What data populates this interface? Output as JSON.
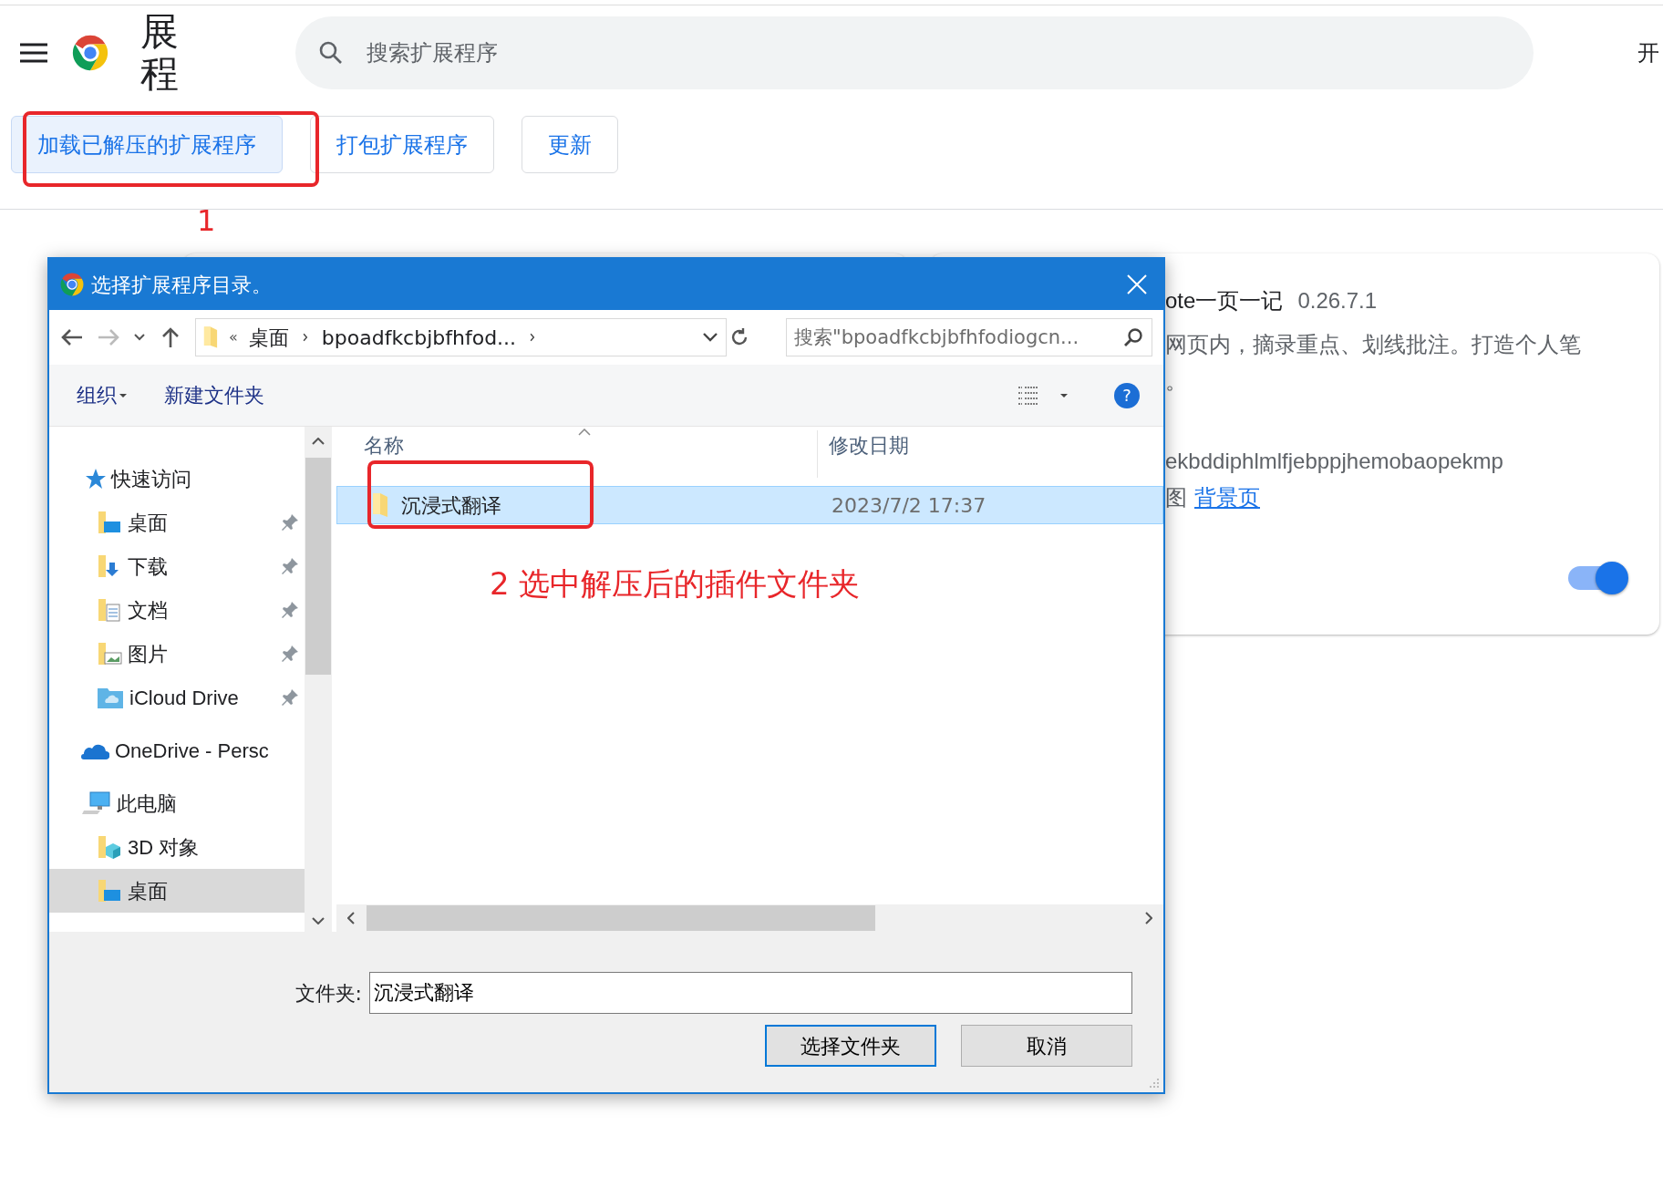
{
  "header": {
    "title": "展程",
    "search": {
      "placeholder": "搜索扩展程序"
    },
    "edge_text": "开"
  },
  "toolbar_buttons": [
    {
      "label": "加载已解压的扩展程序",
      "focused": true
    },
    {
      "label": "打包扩展程序",
      "focused": false
    },
    {
      "label": "更新",
      "focused": false
    }
  ],
  "extension_card": {
    "name": "ote一页一记",
    "version": "0.26.7.1",
    "description_lines": [
      "网页内，摘录重点、划线批注。打造个人笔",
      "。"
    ],
    "id": "ekbddiphlmlfjebppjhemobaopekmp",
    "views_label": "图",
    "views_link": "背景页",
    "enabled": true
  },
  "dialog": {
    "title": "选择扩展程序目录。",
    "path_overflow": "«",
    "path": [
      "桌面",
      "bpoadfkcbjbfhfod..."
    ],
    "search": {
      "placeholder": "搜索\"bpoadfkcbjbfhfodiogcn..."
    },
    "organize": "组织",
    "help_label": "?",
    "new_folder": "新建文件夹",
    "nav": [
      {
        "label": "快速访问",
        "kind": "star",
        "selected": false,
        "children": [
          {
            "label": "桌面",
            "kind": "desktop",
            "pinned": true,
            "selected": false
          },
          {
            "label": "下载",
            "kind": "download",
            "pinned": true,
            "selected": false
          },
          {
            "label": "文档",
            "kind": "documents",
            "pinned": true,
            "selected": false
          },
          {
            "label": "图片",
            "kind": "pictures",
            "pinned": true,
            "selected": false
          },
          {
            "label": "iCloud Drive",
            "kind": "icloud",
            "pinned": true,
            "selected": false
          }
        ]
      },
      {
        "label": "OneDrive - Persc",
        "kind": "onedrive",
        "selected": false
      },
      {
        "label": "此电脑",
        "kind": "computer",
        "selected": false,
        "children": [
          {
            "label": "3D 对象",
            "kind": "objects3d",
            "pinned": false,
            "selected": false
          },
          {
            "label": "桌面",
            "kind": "desktop",
            "pinned": false,
            "selected": true
          }
        ]
      }
    ],
    "columns": [
      "名称",
      "修改日期"
    ],
    "files": [
      {
        "name": "沉浸式翻译",
        "date": "2023/7/2 17:37",
        "selected": true
      }
    ],
    "folder_label": "文件夹:",
    "folder_value": "沉浸式翻译",
    "buttons": [
      {
        "label": "选择文件夹",
        "default": true
      },
      {
        "label": "取消",
        "default": false
      }
    ]
  },
  "annotations": [
    {
      "text": "1"
    },
    {
      "text": "2 选中解压后的插件文件夹"
    }
  ]
}
